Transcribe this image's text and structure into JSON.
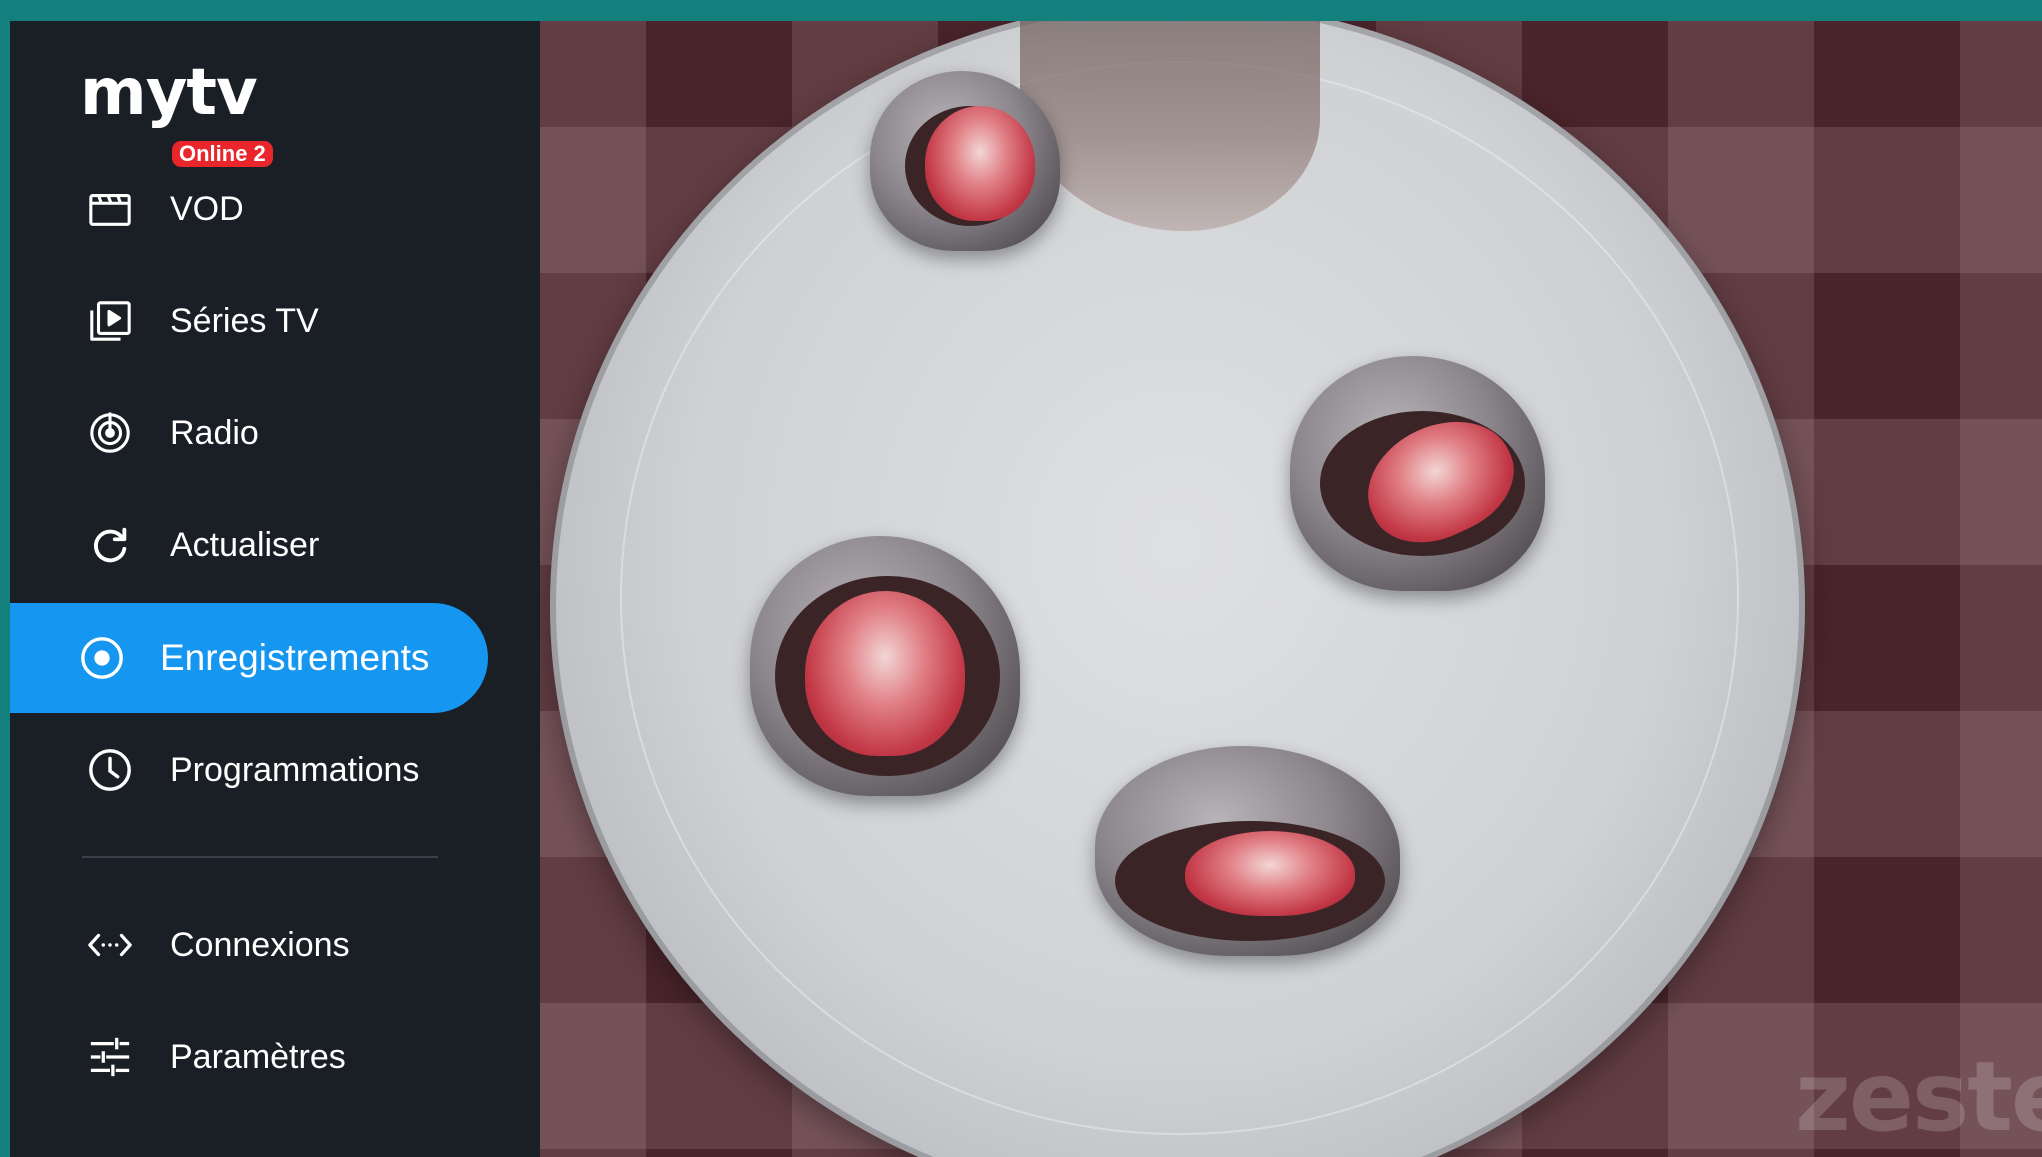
{
  "app": {
    "logo_text": "mytv",
    "logo_badge": "Online 2"
  },
  "menu": {
    "items": [
      {
        "label": "VOD",
        "icon": "clapperboard-icon",
        "active": false
      },
      {
        "label": "Séries TV",
        "icon": "play-library-icon",
        "active": false
      },
      {
        "label": "Radio",
        "icon": "radio-icon",
        "active": false
      },
      {
        "label": "Actualiser",
        "icon": "refresh-icon",
        "active": false
      },
      {
        "label": "Enregistrements",
        "icon": "record-icon",
        "active": true
      },
      {
        "label": "Programmations",
        "icon": "clock-icon",
        "active": false
      }
    ],
    "bottom_items": [
      {
        "label": "Connexions",
        "icon": "connections-icon"
      },
      {
        "label": "Paramètres",
        "icon": "settings-sliders-icon"
      }
    ]
  },
  "video": {
    "watermark": "zeste"
  },
  "colors": {
    "sidebar_bg": "#1a1f25",
    "active_item": "#1496f1",
    "badge": "#e8262b",
    "frame": "#13807e"
  }
}
